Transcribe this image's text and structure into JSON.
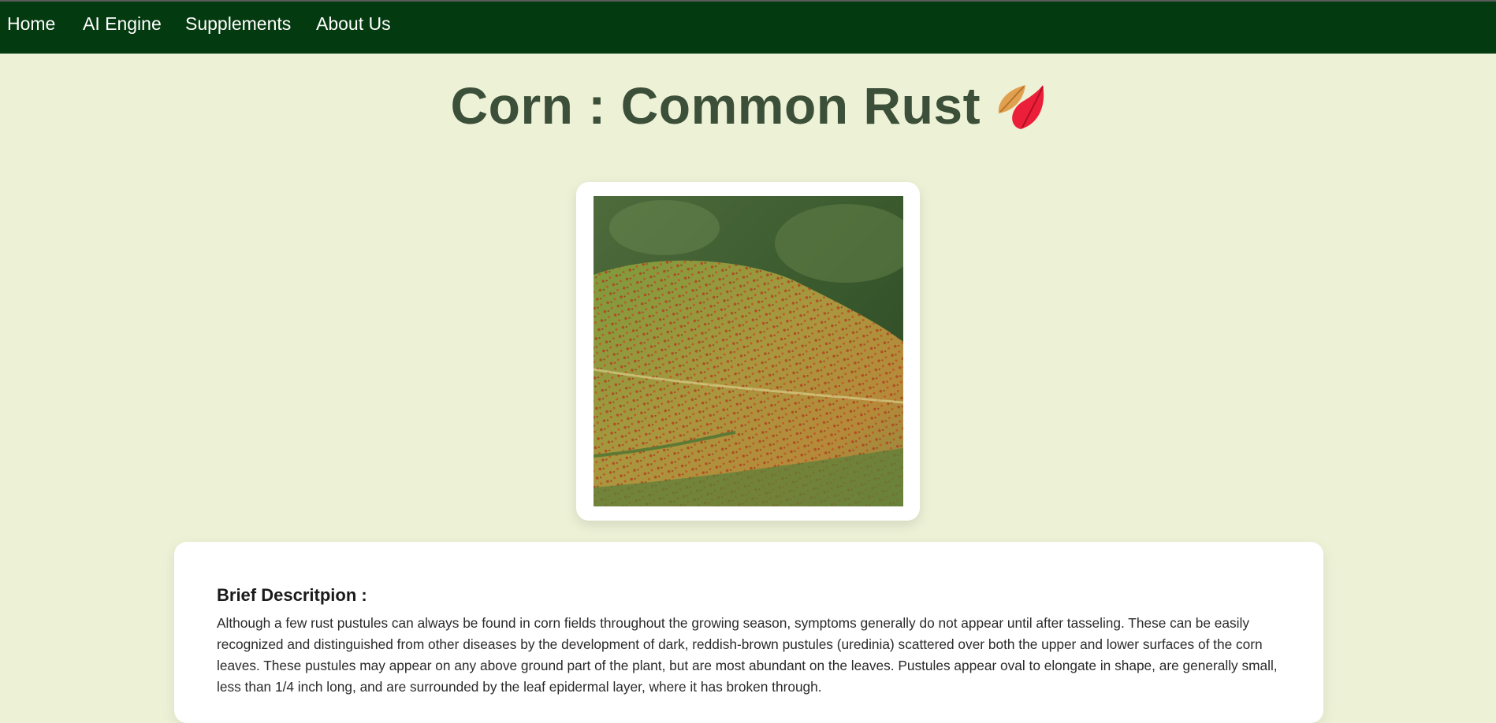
{
  "nav": {
    "items": [
      {
        "label": "Home"
      },
      {
        "label": "AI Engine"
      },
      {
        "label": "Supplements"
      },
      {
        "label": "About Us"
      }
    ]
  },
  "page": {
    "title": "Corn : Common Rust",
    "title_icon": "fallen-leaf-icon"
  },
  "image": {
    "alt": "Corn leaf showing common rust pustules"
  },
  "description": {
    "heading": "Brief Descritpion :",
    "text": "Although a few rust pustules can always be found in corn fields throughout the growing season, symptoms generally do not appear until after tasseling. These can be easily recognized and distinguished from other diseases by the development of dark, reddish-brown pustules (uredinia) scattered over both the upper and lower surfaces of the corn leaves. These pustules may appear on any above ground part of the plant, but are most abundant on the leaves. Pustules appear oval to elongate in shape, are generally small, less than 1/4 inch long, and are surrounded by the leaf epidermal layer, where it has broken through."
  },
  "colors": {
    "navbar": "#043a10",
    "background": "#edf1d6",
    "title": "#3b4f39"
  }
}
